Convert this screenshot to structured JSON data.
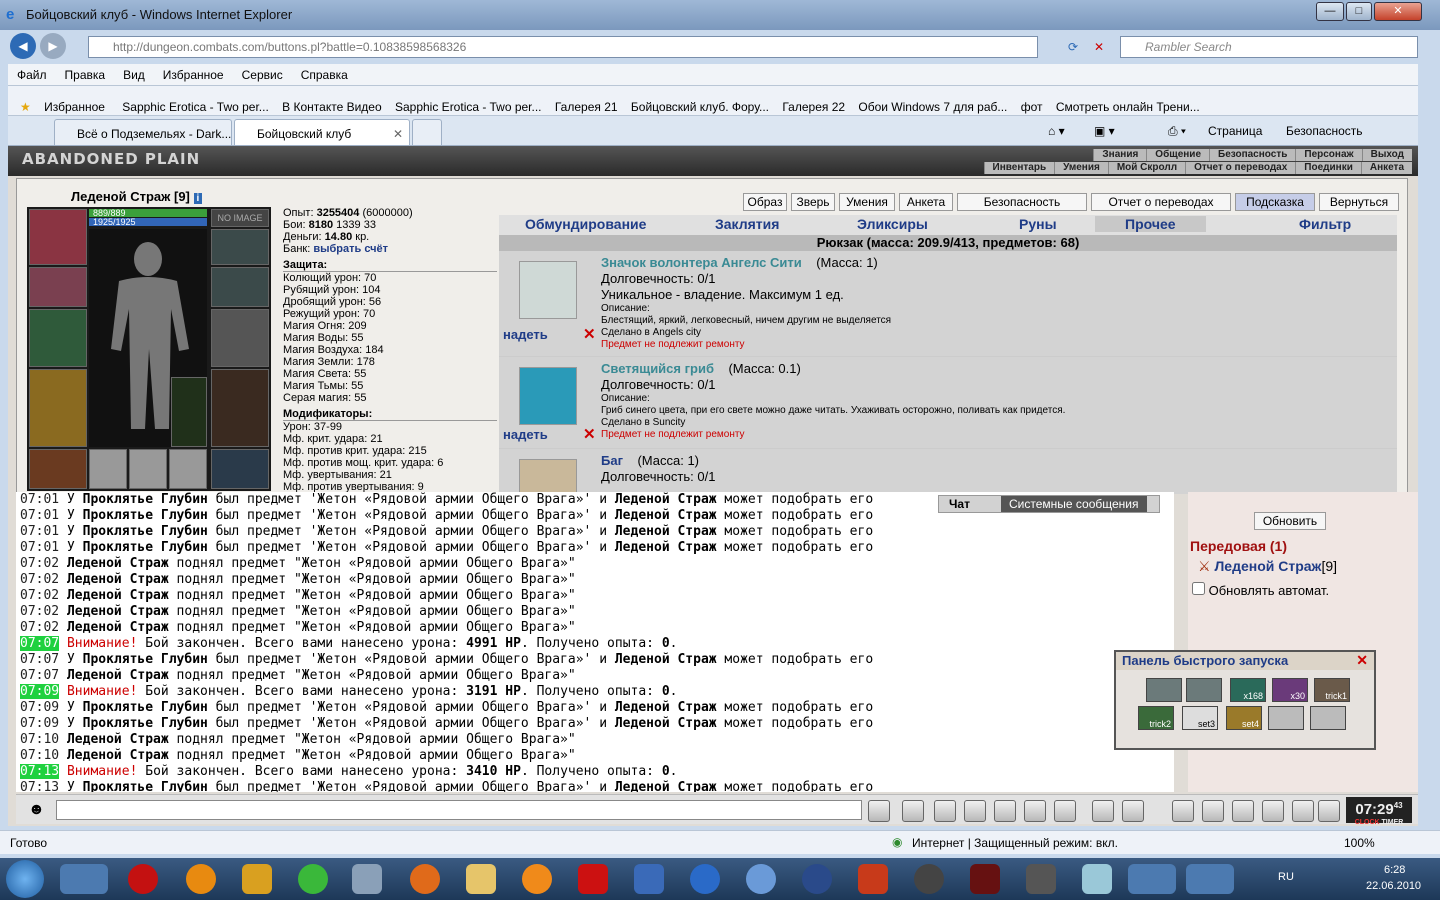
{
  "window": {
    "title": "Бойцовский клуб - Windows Internet Explorer"
  },
  "address": {
    "url": "http://dungeon.combats.com/buttons.pl?battle=0.10838598568326",
    "search_placeholder": "Rambler Search"
  },
  "menu": [
    "Файл",
    "Правка",
    "Вид",
    "Избранное",
    "Сервис",
    "Справка"
  ],
  "favorites": {
    "label": "Избранное",
    "items": [
      "Sapphic Erotica - Two per...",
      "В Контакте Видео",
      "Sapphic Erotica - Two per...",
      "Галерея 21",
      "Бойцовский клуб. Фору...",
      "Галерея 22",
      "Обои Windows 7 для раб...",
      "фот",
      "Смотреть онлайн Трени..."
    ]
  },
  "tabs": [
    {
      "label": "Всё о Подземельях - Dark..."
    },
    {
      "label": "Бойцовский клуб"
    }
  ],
  "commands": {
    "page": "Страница",
    "security": "Безопасность"
  },
  "game": {
    "logo": "ABANDONED PLAIN",
    "nav_row1": [
      "Знания",
      "Общение",
      "Безопасность",
      "Персонаж",
      "Выход"
    ],
    "nav_row2": [
      "Инвентарь",
      "Умения",
      "Мой Скролл",
      "Отчет о переводах",
      "Поединки",
      "Анкета"
    ],
    "char": {
      "name": "Леденой Страж [9]",
      "hp": "889/889",
      "mp": "1925/1925",
      "no_image": "NO IMAGE"
    },
    "info": {
      "exp_label": "Опыт:",
      "exp": "3255404",
      "exp_next": "(6000000)",
      "fights_label": "Бои:",
      "fights": "8180",
      "f2": "1339",
      "f3": "33",
      "money_label": "Деньги:",
      "money": "14.80",
      "money_unit": "кр.",
      "bank_label": "Банк:",
      "bank_link": "выбрать счёт"
    },
    "defense_title": "Защита:",
    "defense": [
      "Колющий урон: 70",
      "Рубящий урон: 104",
      "Дробящий урон: 56",
      "Режущий урон: 70",
      "Магия Огня: 209",
      "Магия Воды: 55",
      "Магия Воздуха: 184",
      "Магия Земли: 178",
      "Магия Света: 55",
      "Магия Тьмы: 55",
      "Серая магия: 55"
    ],
    "mods_title": "Модификаторы:",
    "mods": [
      "Урон: 37-99",
      "Мф. крит. удара: 21",
      "Мф. против крит. удара: 215",
      "Мф. против мощ. крит. удара: 6",
      "Мф. увертывания: 21",
      "Мф. против увертывания: 9"
    ],
    "buttons": [
      "Образ",
      "Зверь",
      "Умения",
      "Анкета",
      "Безопасность",
      "Отчет о переводах",
      "Подсказка",
      "Вернуться"
    ],
    "categories": [
      "Обмундирование",
      "Заклятия",
      "Эликсиры",
      "Руны",
      "Прочее",
      "Фильтр"
    ],
    "backpack": "Рюкзак (масса: 209.9/413, предметов: 68)",
    "items": [
      {
        "name": "Значок волонтера Ангелс Сити",
        "mass": "(Масса: 1)",
        "dur": "Долговечность: 0/1",
        "extra": "Уникальное - владение. Максимум 1 ед.",
        "desc_label": "Описание:",
        "desc": "Блестящий, яркий, легковесный, ничем другим не выделяется",
        "made": "Сделано в Angels city",
        "repair": "Предмет не подлежит ремонту",
        "wear": "надеть"
      },
      {
        "name": "Светящийся гриб",
        "mass": "(Масса: 0.1)",
        "dur": "Долговечность: 0/1",
        "extra": "",
        "desc_label": "Описание:",
        "desc": "Гриб синего цвета, при его свете можно даже читать. Ухаживать осторожно, поливать как придется.",
        "made": "Сделано в Suncity",
        "repair": "Предмет не подлежит ремонту",
        "wear": "надеть"
      },
      {
        "name": "Баг",
        "mass": "(Масса: 1)",
        "dur": "Долговечность: 0/1",
        "extra": "",
        "desc_label": "",
        "desc": "",
        "made": "",
        "repair": "",
        "wear": ""
      }
    ],
    "chat_tabs": [
      "Чат",
      "Системные сообщения"
    ],
    "chat": [
      {
        "t": "07:01",
        "green": false,
        "html": "У <b>Проклятье Глубин</b> был предмет 'Жетон «Рядовой армии Общего Врага»' и <b>Леденой Страж</b> может подобрать его"
      },
      {
        "t": "07:01",
        "green": false,
        "html": "У <b>Проклятье Глубин</b> был предмет 'Жетон «Рядовой армии Общего Врага»' и <b>Леденой Страж</b> может подобрать его"
      },
      {
        "t": "07:01",
        "green": false,
        "html": "У <b>Проклятье Глубин</b> был предмет 'Жетон «Рядовой армии Общего Врага»' и <b>Леденой Страж</b> может подобрать его"
      },
      {
        "t": "07:01",
        "green": false,
        "html": "У <b>Проклятье Глубин</b> был предмет 'Жетон «Рядовой армии Общего Врага»' и <b>Леденой Страж</b> может подобрать его"
      },
      {
        "t": "07:02",
        "green": false,
        "html": "<b>Леденой Страж</b> поднял предмет \"Жетон «Рядовой армии Общего Врага»\""
      },
      {
        "t": "07:02",
        "green": false,
        "html": "<b>Леденой Страж</b> поднял предмет \"Жетон «Рядовой армии Общего Врага»\""
      },
      {
        "t": "07:02",
        "green": false,
        "html": "<b>Леденой Страж</b> поднял предмет \"Жетон «Рядовой армии Общего Врага»\""
      },
      {
        "t": "07:02",
        "green": false,
        "html": "<b>Леденой Страж</b> поднял предмет \"Жетон «Рядовой армии Общего Врага»\""
      },
      {
        "t": "07:02",
        "green": false,
        "html": "<b>Леденой Страж</b> поднял предмет \"Жетон «Рядовой армии Общего Врага»\""
      },
      {
        "t": "07:07",
        "green": true,
        "html": "<span class='warn'>Внимание!</span> Бой закончен. Всего вами нанесено урона: <b>4991 HP</b>. Получено опыта: <b>0</b>."
      },
      {
        "t": "07:07",
        "green": false,
        "html": "У <b>Проклятье Глубин</b> был предмет 'Жетон «Рядовой армии Общего Врага»' и <b>Леденой Страж</b> может подобрать его"
      },
      {
        "t": "07:07",
        "green": false,
        "html": "<b>Леденой Страж</b> поднял предмет \"Жетон «Рядовой армии Общего Врага»\""
      },
      {
        "t": "07:09",
        "green": true,
        "html": "<span class='warn'>Внимание!</span> Бой закончен. Всего вами нанесено урона: <b>3191 HP</b>. Получено опыта: <b>0</b>."
      },
      {
        "t": "07:09",
        "green": false,
        "html": "У <b>Проклятье Глубин</b> был предмет 'Жетон «Рядовой армии Общего Врага»' и <b>Леденой Страж</b> может подобрать его"
      },
      {
        "t": "07:09",
        "green": false,
        "html": "У <b>Проклятье Глубин</b> был предмет 'Жетон «Рядовой армии Общего Врага»' и <b>Леденой Страж</b> может подобрать его"
      },
      {
        "t": "07:10",
        "green": false,
        "html": "<b>Леденой Страж</b> поднял предмет \"Жетон «Рядовой армии Общего Врага»\""
      },
      {
        "t": "07:10",
        "green": false,
        "html": "<b>Леденой Страж</b> поднял предмет \"Жетон «Рядовой армии Общего Врага»\""
      },
      {
        "t": "07:13",
        "green": true,
        "html": "<span class='warn'>Внимание!</span> Бой закончен. Всего вами нанесено урона: <b>3410 HP</b>. Получено опыта: <b>0</b>."
      },
      {
        "t": "07:13",
        "green": false,
        "html": "У <b>Проклятье Глубин</b> был предмет 'Жетон «Рядовой армии Общего Врага»' и <b>Леденой Страж</b> может подобрать его"
      }
    ],
    "right": {
      "update": "Обновить",
      "group": "Передовая (1)",
      "player": "Леденой Страж",
      "player_level": "[9]",
      "auto": "Обновлять автомат."
    },
    "quick": {
      "title": "Панель быстрого запуска",
      "slots": [
        "",
        "",
        "x168",
        "x30",
        "trick1",
        "trick2",
        "set3",
        "set4",
        "",
        ""
      ]
    },
    "clock": {
      "time": "07:29",
      "sec": "43",
      "l1": "CLOCK",
      "l2": "TIMER"
    }
  },
  "status": {
    "left": "Готово",
    "zone": "Интернет | Защищенный режим: вкл.",
    "zoom": "100%"
  },
  "tray": {
    "lang": "RU",
    "time": "6:28",
    "date": "22.06.2010"
  }
}
